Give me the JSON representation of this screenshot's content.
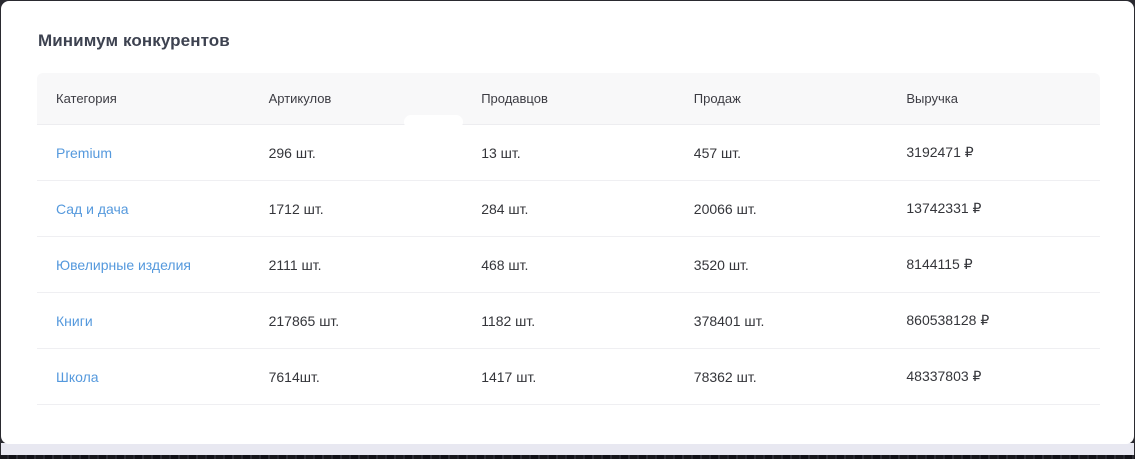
{
  "card": {
    "title": "Минимум конкурентов"
  },
  "table": {
    "columns": [
      {
        "label": "Категория"
      },
      {
        "label": "Артикулов"
      },
      {
        "label": "Продавцов"
      },
      {
        "label": "Продаж"
      },
      {
        "label": "Выручка"
      }
    ],
    "rows": [
      {
        "category": "Premium",
        "articles": "296 шт.",
        "sellers": "13 шт.",
        "sales": "457 шт.",
        "revenue": "3192471 ₽"
      },
      {
        "category": "Сад и дача",
        "articles": "1712 шт.",
        "sellers": "284 шт.",
        "sales": "20066 шт.",
        "revenue": "13742331 ₽"
      },
      {
        "category": "Ювелирные изделия",
        "articles": "2111 шт.",
        "sellers": "468 шт.",
        "sales": "3520 шт.",
        "revenue": "8144115 ₽"
      },
      {
        "category": "Книги",
        "articles": "217865 шт.",
        "sellers": "1182 шт.",
        "sales": "378401 шт.",
        "revenue": "860538128 ₽"
      },
      {
        "category": "Школа",
        "articles": "7614шт.",
        "sellers": "1417 шт.",
        "sales": "78362 шт.",
        "revenue": "48337803 ₽"
      }
    ]
  },
  "colors": {
    "link_blue": "#5599dd",
    "header_bg": "#f8f8f9",
    "title_text": "#3d4250",
    "cell_text": "#34353a",
    "page_band": "#e8e8f1"
  }
}
